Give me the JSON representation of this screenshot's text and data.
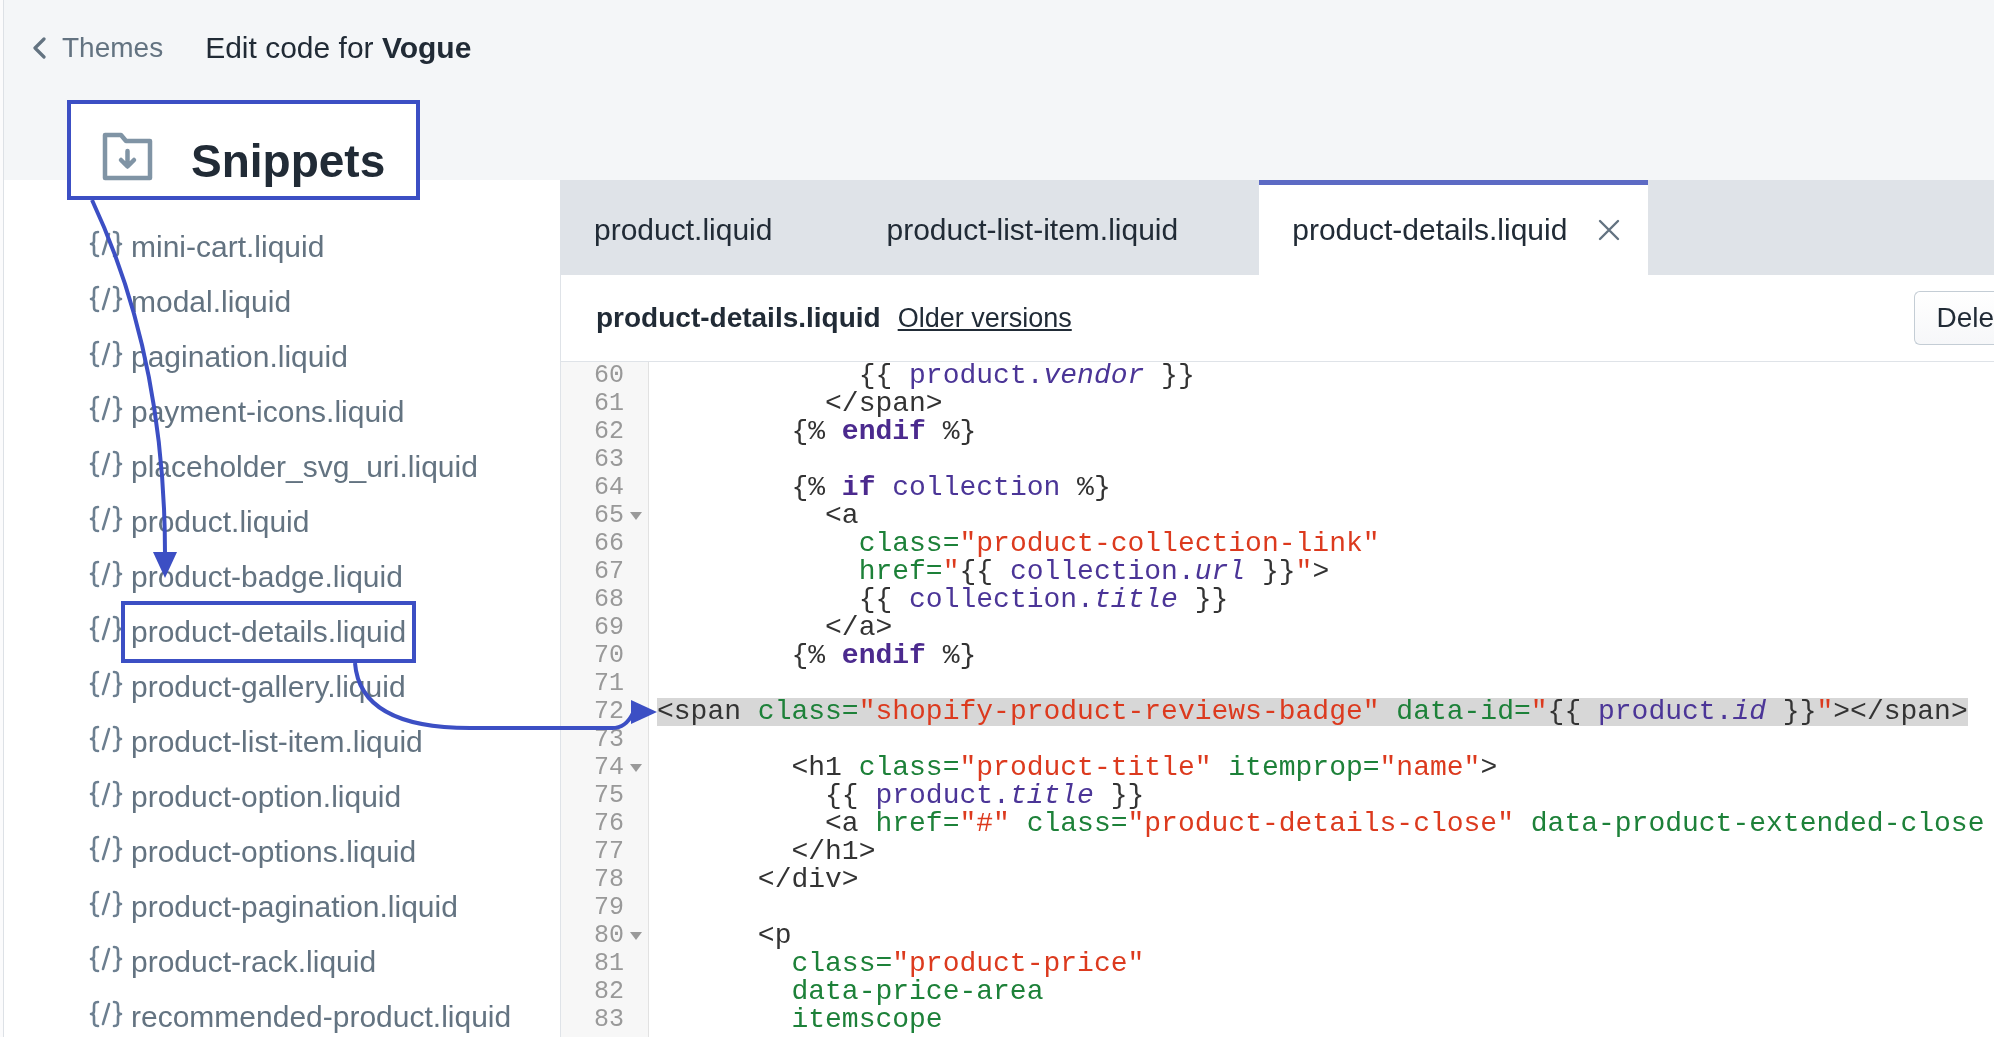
{
  "header": {
    "back_link": "Themes",
    "title": "Edit code for **Vogue**"
  },
  "sidebar": {
    "section": {
      "title": "Snippets",
      "highlighted": true
    },
    "items": [
      {
        "name": "mini-cart.liquid",
        "highlighted": false
      },
      {
        "name": "modal.liquid",
        "highlighted": false
      },
      {
        "name": "pagination.liquid",
        "highlighted": false
      },
      {
        "name": "payment-icons.liquid",
        "highlighted": false
      },
      {
        "name": "placeholder_svg_uri.liquid",
        "highlighted": false
      },
      {
        "name": "product.liquid",
        "highlighted": false
      },
      {
        "name": "product-badge.liquid",
        "highlighted": false
      },
      {
        "name": "product-details.liquid",
        "highlighted": true
      },
      {
        "name": "product-gallery.liquid",
        "highlighted": false
      },
      {
        "name": "product-list-item.liquid",
        "highlighted": false
      },
      {
        "name": "product-option.liquid",
        "highlighted": false
      },
      {
        "name": "product-options.liquid",
        "highlighted": false
      },
      {
        "name": "product-pagination.liquid",
        "highlighted": false
      },
      {
        "name": "product-rack.liquid",
        "highlighted": false
      },
      {
        "name": "recommended-product.liquid",
        "highlighted": false
      }
    ]
  },
  "editor": {
    "tabs": [
      {
        "label": "product.liquid",
        "selected": false
      },
      {
        "label": "product-list-item.liquid",
        "selected": false
      },
      {
        "label": "product-details.liquid",
        "selected": true
      }
    ],
    "toolbar": {
      "file_name": "product-details.liquid",
      "link": "Older versions",
      "button": "Dele"
    },
    "code": {
      "lines": [
        {
          "number": "60",
          "selected": false,
          "fold": false,
          "tokens": [
            {
              "kind": "plain",
              "text": "            {{ "
            },
            {
              "kind": "var",
              "text": "product."
            },
            {
              "kind": "prop",
              "text": "vendor"
            },
            {
              "kind": "plain",
              "text": " }}"
            }
          ]
        },
        {
          "number": "61",
          "selected": false,
          "fold": false,
          "tokens": [
            {
              "kind": "plain",
              "text": "          </span>"
            }
          ]
        },
        {
          "number": "62",
          "selected": false,
          "fold": false,
          "tokens": [
            {
              "kind": "plain",
              "text": "        {% "
            },
            {
              "kind": "keyword",
              "text": "endif"
            },
            {
              "kind": "plain",
              "text": " %}"
            }
          ]
        },
        {
          "number": "63",
          "selected": false,
          "fold": false
        },
        {
          "number": "64",
          "selected": false,
          "fold": false,
          "tokens": [
            {
              "kind": "plain",
              "text": "        {% "
            },
            {
              "kind": "keyword",
              "text": "if"
            },
            {
              "kind": "var",
              "text": " collection"
            },
            {
              "kind": "plain",
              "text": " %}"
            }
          ]
        },
        {
          "number": "65",
          "selected": false,
          "fold": true,
          "tokens": [
            {
              "kind": "plain",
              "text": "          <a"
            }
          ]
        },
        {
          "number": "66",
          "selected": false,
          "fold": false,
          "tokens": [
            {
              "kind": "attr",
              "text": "            class="
            },
            {
              "kind": "string",
              "text": "\"product-collection-link\""
            }
          ]
        },
        {
          "number": "67",
          "selected": false,
          "fold": false,
          "tokens": [
            {
              "kind": "attr",
              "text": "            href="
            },
            {
              "kind": "string",
              "text": "\""
            },
            {
              "kind": "plain",
              "text": "{{ "
            },
            {
              "kind": "var",
              "text": "collection."
            },
            {
              "kind": "prop",
              "text": "url"
            },
            {
              "kind": "plain",
              "text": " }}"
            },
            {
              "kind": "string",
              "text": "\""
            },
            {
              "kind": "plain",
              "text": ">"
            }
          ]
        },
        {
          "number": "68",
          "selected": false,
          "fold": false,
          "tokens": [
            {
              "kind": "plain",
              "text": "            {{ "
            },
            {
              "kind": "var",
              "text": "collection."
            },
            {
              "kind": "prop",
              "text": "title"
            },
            {
              "kind": "plain",
              "text": " }}"
            }
          ]
        },
        {
          "number": "69",
          "selected": false,
          "fold": false,
          "tokens": [
            {
              "kind": "plain",
              "text": "          </a>"
            }
          ]
        },
        {
          "number": "70",
          "selected": false,
          "fold": false,
          "tokens": [
            {
              "kind": "plain",
              "text": "        {% "
            },
            {
              "kind": "keyword",
              "text": "endif"
            },
            {
              "kind": "plain",
              "text": " %}"
            }
          ]
        },
        {
          "number": "71",
          "selected": false,
          "fold": false
        },
        {
          "number": "72",
          "selected": true,
          "fold": false,
          "tokens": [
            {
              "kind": "plain",
              "text": "<span "
            },
            {
              "kind": "attr",
              "text": "class="
            },
            {
              "kind": "string",
              "text": "\"shopify-product-reviews-badge\""
            },
            {
              "kind": "attr",
              "text": " data-id="
            },
            {
              "kind": "string",
              "text": "\""
            },
            {
              "kind": "plain",
              "text": "{{ "
            },
            {
              "kind": "var",
              "text": "product."
            },
            {
              "kind": "prop",
              "text": "id"
            },
            {
              "kind": "plain",
              "text": " }}"
            },
            {
              "kind": "string",
              "text": "\""
            },
            {
              "kind": "plain",
              "text": "></span>"
            }
          ]
        },
        {
          "number": "73",
          "selected": false,
          "fold": false
        },
        {
          "number": "74",
          "selected": false,
          "fold": true,
          "tokens": [
            {
              "kind": "plain",
              "text": "        <h1 "
            },
            {
              "kind": "attr",
              "text": "class="
            },
            {
              "kind": "string",
              "text": "\"product-title\""
            },
            {
              "kind": "attr",
              "text": " itemprop="
            },
            {
              "kind": "string",
              "text": "\"name\""
            },
            {
              "kind": "plain",
              "text": ">"
            }
          ]
        },
        {
          "number": "75",
          "selected": false,
          "fold": false,
          "tokens": [
            {
              "kind": "plain",
              "text": "          {{ "
            },
            {
              "kind": "var",
              "text": "product."
            },
            {
              "kind": "prop",
              "text": "title"
            },
            {
              "kind": "plain",
              "text": " }}"
            }
          ]
        },
        {
          "number": "76",
          "selected": false,
          "fold": false,
          "tokens": [
            {
              "kind": "plain",
              "text": "          <a "
            },
            {
              "kind": "attr",
              "text": "href="
            },
            {
              "kind": "string",
              "text": "\"#\""
            },
            {
              "kind": "attr",
              "text": " class="
            },
            {
              "kind": "string",
              "text": "\"product-details-close\""
            },
            {
              "kind": "attr",
              "text": " data-product-extended-close"
            }
          ]
        },
        {
          "number": "77",
          "selected": false,
          "fold": false,
          "tokens": [
            {
              "kind": "plain",
              "text": "        </h1>"
            }
          ]
        },
        {
          "number": "78",
          "selected": false,
          "fold": false,
          "tokens": [
            {
              "kind": "plain",
              "text": "      </div>"
            }
          ]
        },
        {
          "number": "79",
          "selected": false,
          "fold": false
        },
        {
          "number": "80",
          "selected": false,
          "fold": true,
          "tokens": [
            {
              "kind": "plain",
              "text": "      <p"
            }
          ]
        },
        {
          "number": "81",
          "selected": false,
          "fold": false,
          "tokens": [
            {
              "kind": "attr",
              "text": "        class="
            },
            {
              "kind": "string",
              "text": "\"product-price\""
            }
          ]
        },
        {
          "number": "82",
          "selected": false,
          "fold": false,
          "tokens": [
            {
              "kind": "attr",
              "text": "        data-price-area"
            }
          ]
        },
        {
          "number": "83",
          "selected": false,
          "fold": false,
          "tokens": [
            {
              "kind": "attr",
              "text": "        itemscope"
            }
          ]
        }
      ]
    }
  }
}
